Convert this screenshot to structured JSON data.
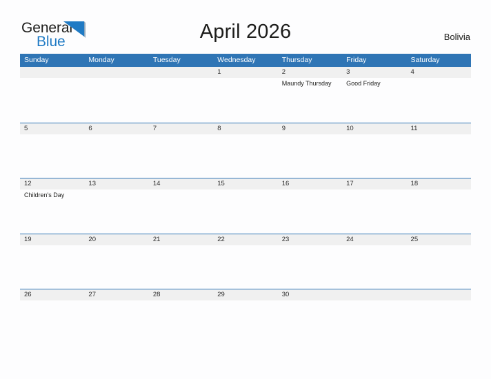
{
  "brand": {
    "word_one": "General",
    "word_two": "Blue",
    "flag_icon": "blue-triangle-flag-icon",
    "color_dark": "#1d1d1b",
    "color_blue": "#1f7ac4"
  },
  "header": {
    "title": "April 2026",
    "country": "Bolivia"
  },
  "theme": {
    "header_blue": "#2f75b5",
    "row_border_blue": "#2f75b5",
    "day_band_gray": "#f0f0f0",
    "page_background": "#fdfdfe",
    "text_dark": "#1d1d1b"
  },
  "calendar": {
    "weekdays": [
      "Sunday",
      "Monday",
      "Tuesday",
      "Wednesday",
      "Thursday",
      "Friday",
      "Saturday"
    ],
    "weeks": [
      [
        {
          "day": "",
          "events": []
        },
        {
          "day": "",
          "events": []
        },
        {
          "day": "",
          "events": []
        },
        {
          "day": "1",
          "events": []
        },
        {
          "day": "2",
          "events": [
            "Maundy Thursday"
          ]
        },
        {
          "day": "3",
          "events": [
            "Good Friday"
          ]
        },
        {
          "day": "4",
          "events": []
        }
      ],
      [
        {
          "day": "5",
          "events": []
        },
        {
          "day": "6",
          "events": []
        },
        {
          "day": "7",
          "events": []
        },
        {
          "day": "8",
          "events": []
        },
        {
          "day": "9",
          "events": []
        },
        {
          "day": "10",
          "events": []
        },
        {
          "day": "11",
          "events": []
        }
      ],
      [
        {
          "day": "12",
          "events": [
            "Children's Day"
          ]
        },
        {
          "day": "13",
          "events": []
        },
        {
          "day": "14",
          "events": []
        },
        {
          "day": "15",
          "events": []
        },
        {
          "day": "16",
          "events": []
        },
        {
          "day": "17",
          "events": []
        },
        {
          "day": "18",
          "events": []
        }
      ],
      [
        {
          "day": "19",
          "events": []
        },
        {
          "day": "20",
          "events": []
        },
        {
          "day": "21",
          "events": []
        },
        {
          "day": "22",
          "events": []
        },
        {
          "day": "23",
          "events": []
        },
        {
          "day": "24",
          "events": []
        },
        {
          "day": "25",
          "events": []
        }
      ],
      [
        {
          "day": "26",
          "events": []
        },
        {
          "day": "27",
          "events": []
        },
        {
          "day": "28",
          "events": []
        },
        {
          "day": "29",
          "events": []
        },
        {
          "day": "30",
          "events": []
        },
        {
          "day": "",
          "events": []
        },
        {
          "day": "",
          "events": []
        }
      ]
    ]
  }
}
